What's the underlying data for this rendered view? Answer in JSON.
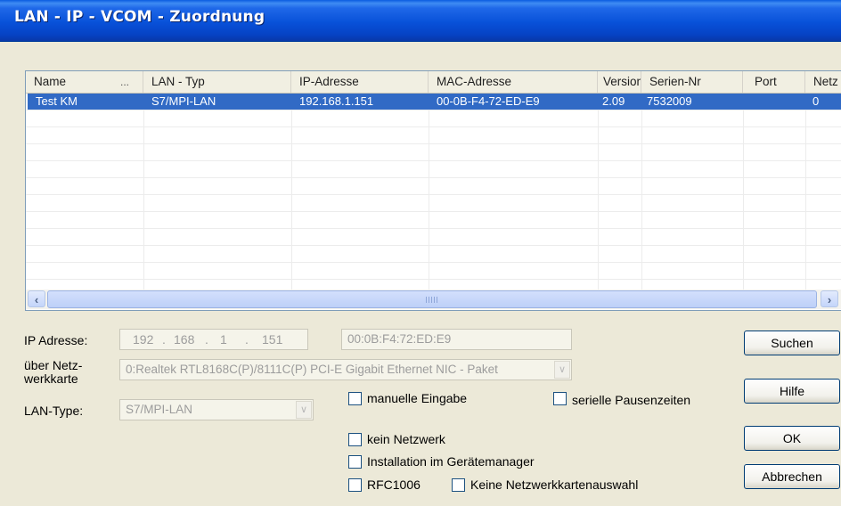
{
  "window": {
    "title": "LAN - IP - VCOM - Zuordnung"
  },
  "list": {
    "columns": [
      "Name",
      "...",
      "LAN - Typ",
      "IP-Adresse",
      "MAC-Adresse",
      "Version",
      "Serien-Nr",
      "Port",
      "Netz"
    ],
    "rows": [
      {
        "name": "Test KM",
        "lan_typ": "S7/MPI-LAN",
        "ip": "192.168.1.151",
        "mac": "00-0B-F4-72-ED-E9",
        "version": "2.09",
        "serien_nr": "7532009",
        "port": "",
        "netz": "0"
      }
    ],
    "selected_row": 0,
    "scroll_left_icon": "scroll-left-arrow-icon",
    "scroll_right_icon": "scroll-right-arrow-icon"
  },
  "form": {
    "ip_label": "IP Adresse:",
    "ip_octets": [
      "192",
      "168",
      "1",
      "151"
    ],
    "mac_value": "00:0B:F4:72:ED:E9",
    "adapter_label": "über Netz-\nwerkkarte",
    "adapter_value": "0:Realtek RTL8168C(P)/8111C(P) PCI-E Gigabit Ethernet NIC - Paket",
    "lantype_label": "LAN-Type:",
    "lantype_value": "S7/MPI-LAN",
    "checkboxes": {
      "manuelle": "manuelle Eingabe",
      "serielle": "serielle Pausenzeiten",
      "kein_netz": "kein Netzwerk",
      "installation": "Installation im Gerätemanager",
      "rfc": "RFC1006",
      "keine_auswahl": "Keine Netzwerkkartenauswahl"
    }
  },
  "buttons": {
    "suchen": "Suchen",
    "hilfe": "Hilfe",
    "ok": "OK",
    "abbrechen": "Abbrechen"
  },
  "colors": {
    "titlebar": "#0851d9",
    "selection": "#316ac5",
    "dialog_bg": "#ece9d8"
  }
}
